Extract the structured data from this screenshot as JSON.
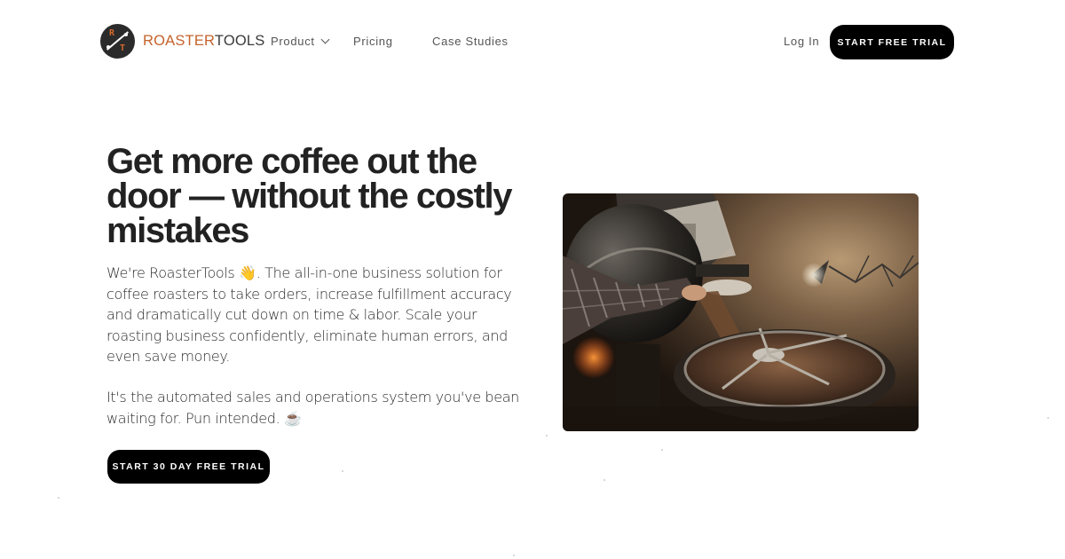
{
  "brand": {
    "name_part1": "ROASTER",
    "name_part2": "TOOLS",
    "accent_color": "#c5622b"
  },
  "nav": {
    "product": "Product",
    "pricing": "Pricing",
    "case_studies": "Case Studies",
    "login": "Log In",
    "cta": "START FREE TRIAL"
  },
  "hero": {
    "title": "Get more coffee out the door — without the costly mistakes",
    "paragraph1": "We're RoasterTools 👋. The all-in-one business solution for coffee roasters to take orders, increase fulfillment accuracy and dramatically cut down on time & labor. Scale your roasting business confidently, eliminate human errors, and even save money.",
    "paragraph2": "It's the automated sales and operations system you've bean waiting for. Pun intended. ☕",
    "cta": "START 30 DAY FREE TRIAL"
  },
  "icons": {
    "logo": "roastertools-logo-icon",
    "product_dropdown": "chevron-down-icon"
  }
}
